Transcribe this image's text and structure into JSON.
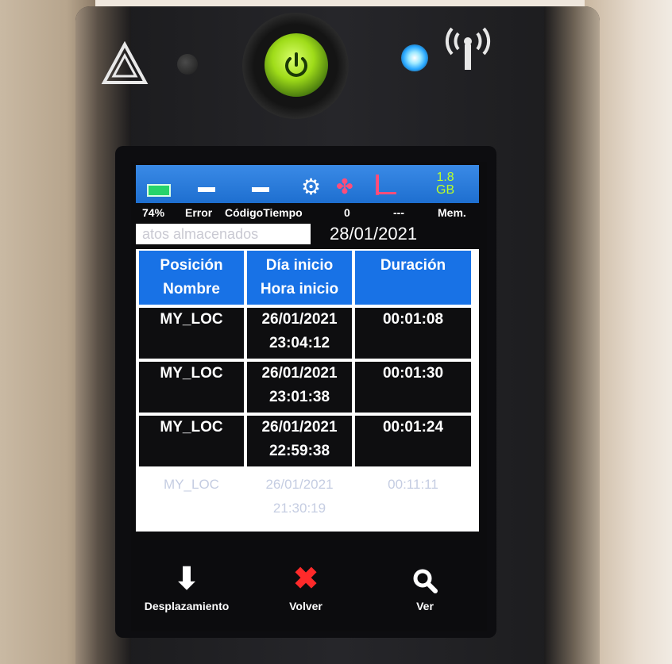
{
  "status": {
    "battery_pct": "74%",
    "error_label": "Error",
    "code_label": "CódigoTiempo",
    "zero_label": "0",
    "dash_label": "---",
    "mem_label": "Mem.",
    "mem_value_top": "1.8",
    "mem_value_unit": "GB"
  },
  "screen": {
    "title": "atos almacenados",
    "date": "28/01/2021"
  },
  "table": {
    "headers": [
      {
        "line1": "Posición",
        "line2": "Nombre"
      },
      {
        "line1": "Día inicio",
        "line2": "Hora inicio"
      },
      {
        "line1": "Duración",
        "line2": ""
      }
    ],
    "rows": [
      {
        "name": "MY_LOC",
        "date": "26/01/2021",
        "time": "23:04:12",
        "duration": "00:01:08"
      },
      {
        "name": "MY_LOC",
        "date": "26/01/2021",
        "time": "23:01:38",
        "duration": "00:01:30"
      },
      {
        "name": "MY_LOC",
        "date": "26/01/2021",
        "time": "22:59:38",
        "duration": "00:01:24"
      }
    ],
    "partial_row": {
      "name": "MY_LOC",
      "date": "26/01/2021",
      "time": "21:30:19",
      "duration": "00:11:11"
    }
  },
  "bottom": {
    "scroll_label": "Desplazamiento",
    "back_label": "Volver",
    "view_label": "Ver"
  },
  "colors": {
    "header_blue": "#1872e6",
    "power_green": "#9fdc19",
    "led_blue": "#26a6ff",
    "close_red": "#ff2a2a"
  },
  "icons": [
    "warning-icon",
    "power-icon",
    "antenna-icon",
    "battery-icon",
    "gear-icon",
    "fan-icon",
    "signal-icon",
    "arrow-down-icon",
    "close-icon",
    "search-icon"
  ]
}
